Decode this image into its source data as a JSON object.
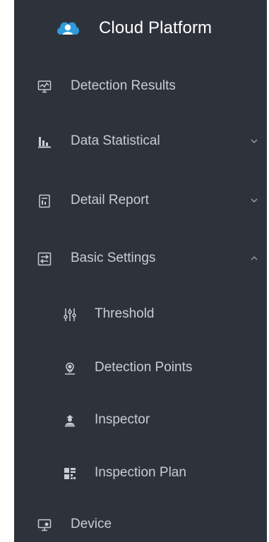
{
  "brand": {
    "title": "Cloud Platform",
    "icon": "cloud-icon"
  },
  "menu": {
    "detection_results": {
      "label": "Detection Results",
      "icon": "monitor-chart-icon"
    },
    "data_statistical": {
      "label": "Data Statistical",
      "icon": "bar-chart-icon",
      "expanded": false
    },
    "detail_report": {
      "label": "Detail Report",
      "icon": "report-icon",
      "expanded": false
    },
    "basic_settings": {
      "label": "Basic Settings",
      "icon": "settings-toggle-icon",
      "expanded": true,
      "children": {
        "threshold": {
          "label": "Threshold",
          "icon": "sliders-icon"
        },
        "detection_points": {
          "label": "Detection Points",
          "icon": "location-pin-icon"
        },
        "inspector": {
          "label": "Inspector",
          "icon": "person-icon"
        },
        "inspection_plan": {
          "label": "Inspection Plan",
          "icon": "plan-icon"
        }
      }
    },
    "device": {
      "label": "Device",
      "icon": "device-icon"
    }
  },
  "colors": {
    "sidebar_bg": "#2e323b",
    "text": "#c9ccd2",
    "brand_text": "#ffffff",
    "brand_icon": "#2f9bd8"
  }
}
